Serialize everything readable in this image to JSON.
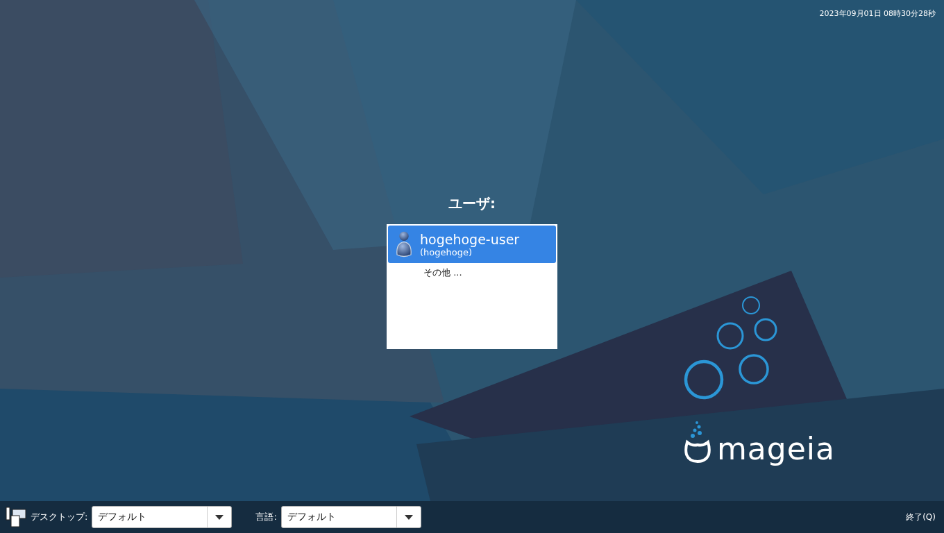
{
  "clock": "2023年09月01日 08時30分28秒",
  "user_panel": {
    "title": "ユーザ:",
    "items": [
      {
        "kind": "user",
        "name": "hogehoge-user",
        "login": "(hogehoge)",
        "selected": true
      },
      {
        "kind": "other",
        "name": "その他 ...",
        "selected": false
      }
    ]
  },
  "logo": {
    "text": "mageia"
  },
  "bottom_bar": {
    "desktop": {
      "label": "デスクトップ:",
      "value": "デフォルト"
    },
    "language": {
      "label": "言語:",
      "value": "デフォルト"
    },
    "quit": "終了(Q)"
  }
}
